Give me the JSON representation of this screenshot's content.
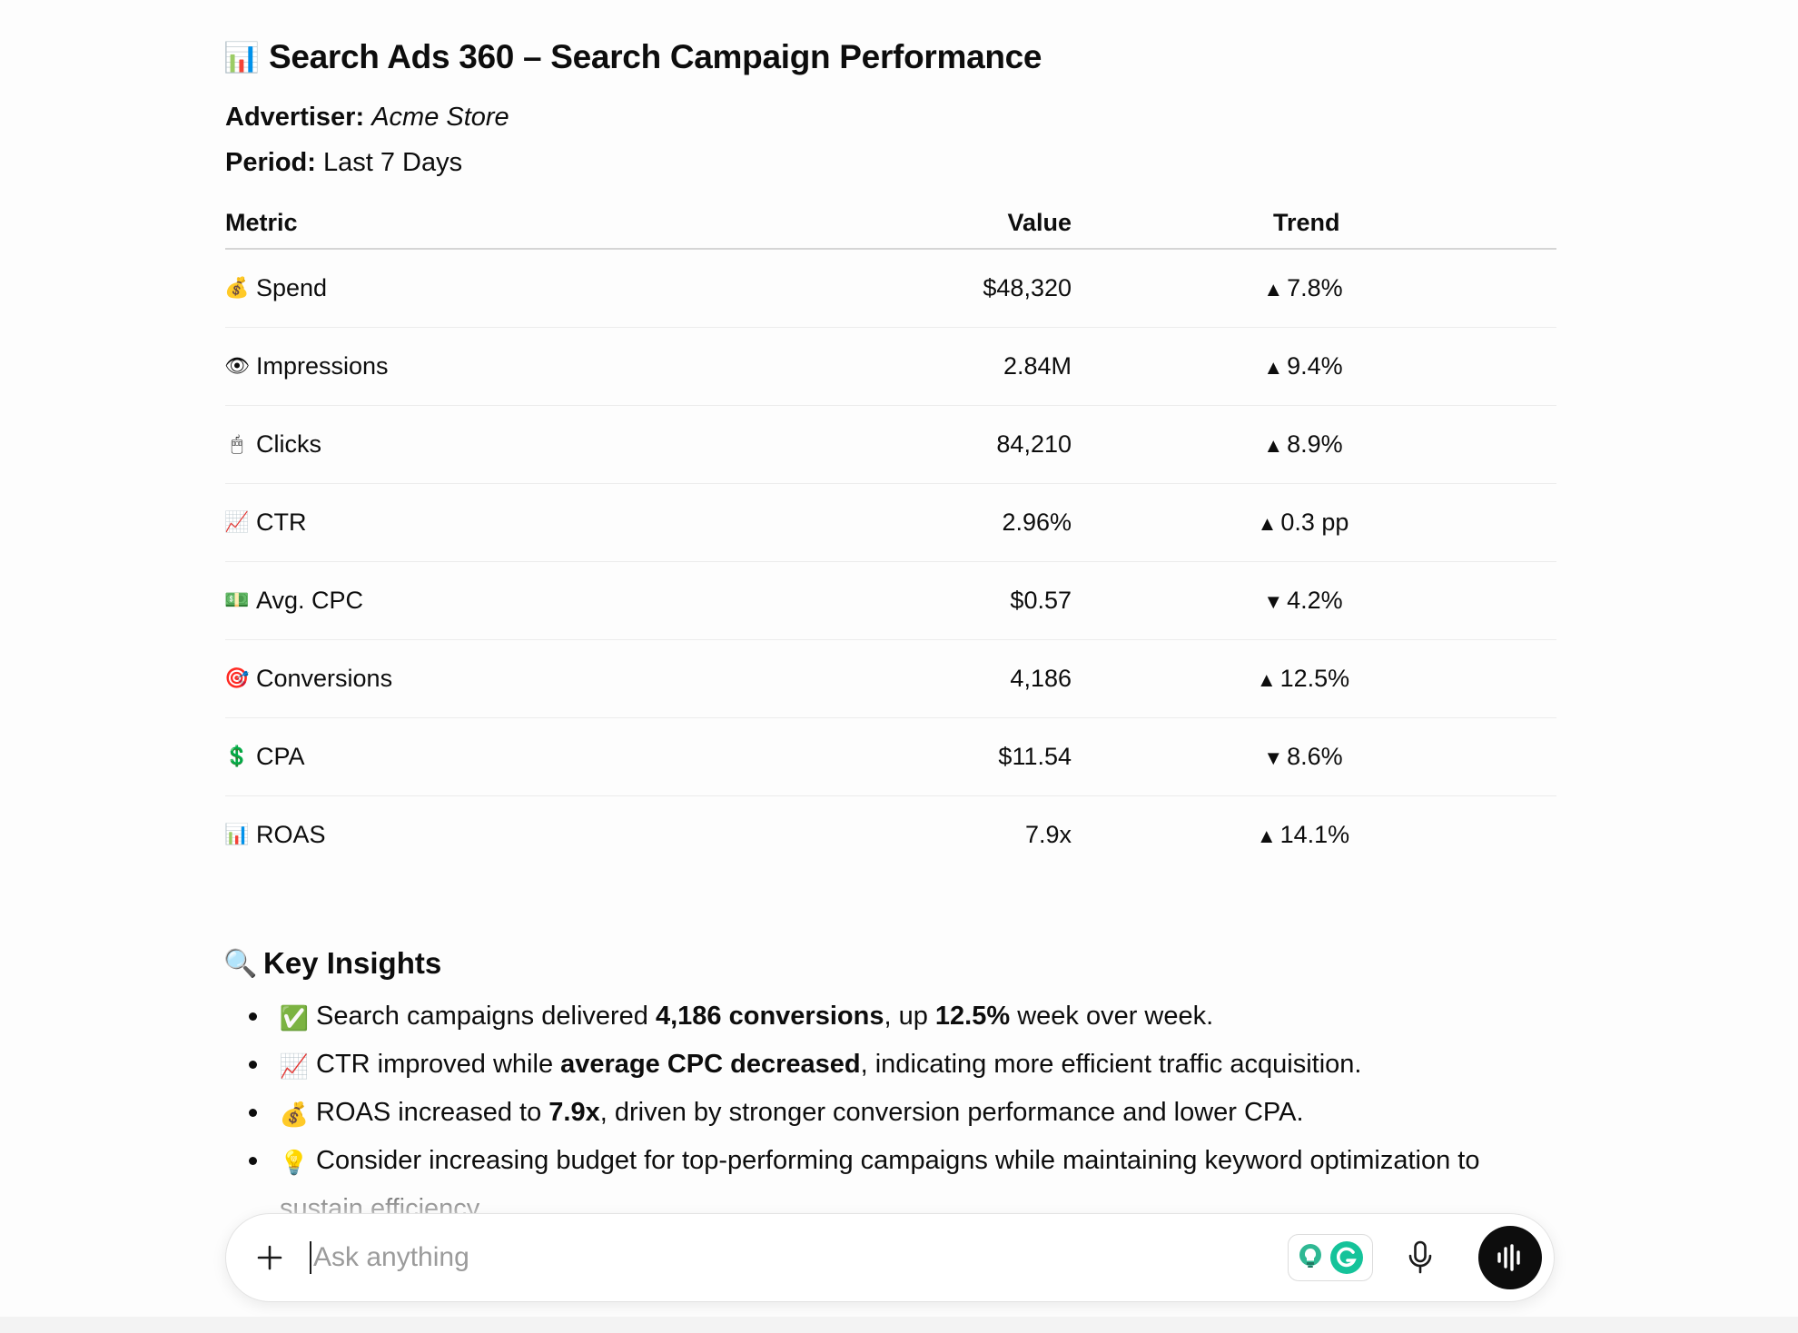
{
  "report": {
    "title_icon": "bar-chart-emoji",
    "title_icon_glyph": "📊",
    "title": "Search Ads 360 – Search Campaign Performance",
    "advertiser_label": "Advertiser:",
    "advertiser_value": "Acme Store",
    "period_label": "Period:",
    "period_value": "Last 7 Days"
  },
  "table": {
    "headers": {
      "metric": "Metric",
      "value": "Value",
      "trend": "Trend"
    },
    "rows": [
      {
        "icon": "money-bag-icon",
        "glyph": "💰",
        "metric": "Spend",
        "value": "$48,320",
        "arrow": "▲",
        "trend": "7.8%"
      },
      {
        "icon": "eye-icon",
        "glyph": "👁",
        "metric": "Impressions",
        "value": "2.84M",
        "arrow": "▲",
        "trend": "9.4%"
      },
      {
        "icon": "mouse-icon",
        "glyph": "🖱",
        "metric": "Clicks",
        "value": "84,210",
        "arrow": "▲",
        "trend": "8.9%"
      },
      {
        "icon": "chart-increasing-icon",
        "glyph": "📈",
        "metric": "CTR",
        "value": "2.96%",
        "arrow": "▲",
        "trend": "0.3 pp"
      },
      {
        "icon": "dollar-banknote-icon",
        "glyph": "💵",
        "metric": "Avg. CPC",
        "value": "$0.57",
        "arrow": "▼",
        "trend": "4.2%"
      },
      {
        "icon": "target-icon",
        "glyph": "🎯",
        "metric": "Conversions",
        "value": "4,186",
        "arrow": "▲",
        "trend": "12.5%"
      },
      {
        "icon": "dollar-sign-icon",
        "glyph": "💲",
        "metric": "CPA",
        "value": "$11.54",
        "arrow": "▼",
        "trend": "8.6%"
      },
      {
        "icon": "bar-chart-icon",
        "glyph": "📊",
        "metric": "ROAS",
        "value": "7.9x",
        "arrow": "▲",
        "trend": "14.1%"
      }
    ]
  },
  "insights": {
    "title_icon": "magnifier-icon",
    "title_icon_glyph": "🔍",
    "title": "Key Insights",
    "items": [
      {
        "icon": "check-mark-icon",
        "glyph": "✅",
        "parts": [
          "Search campaigns delivered ",
          "4,186 conversions",
          ", up ",
          "12.5%",
          " week over week."
        ]
      },
      {
        "icon": "chart-increasing-icon",
        "glyph": "📈",
        "parts": [
          "CTR improved while ",
          "average CPC decreased",
          ", indicating more efficient traffic acquisition."
        ]
      },
      {
        "icon": "money-bag-icon",
        "glyph": "💰",
        "parts": [
          "ROAS increased to ",
          "7.9x",
          ", driven by stronger conversion performance and lower CPA."
        ]
      },
      {
        "icon": "light-bulb-icon",
        "glyph": "💡",
        "parts": [
          "Consider increasing budget for top-performing campaigns while maintaining keyword optimization to sustain efficiency."
        ]
      }
    ]
  },
  "composer": {
    "plus_glyph": "+",
    "placeholder": "Ask anything"
  },
  "colors": {
    "text": "#0d0d0d",
    "voice_button": "#0d0d0d",
    "grammarly_green": "#15c39a"
  }
}
